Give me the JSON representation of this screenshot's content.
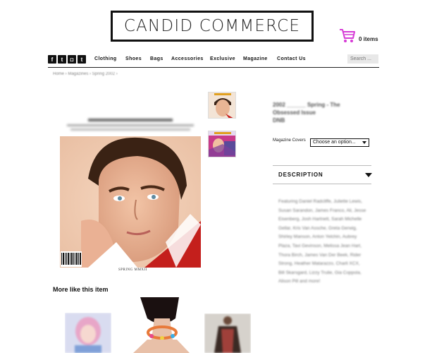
{
  "brand": {
    "logo_text": "CANDID COMMERCE"
  },
  "cart": {
    "count_label": "0 items",
    "icon": "shopping-cart-icon",
    "icon_color": "#d63ad6"
  },
  "social": [
    {
      "name": "facebook",
      "glyph": "f"
    },
    {
      "name": "twitter",
      "glyph": "t"
    },
    {
      "name": "instagram",
      "glyph": "◘"
    },
    {
      "name": "tumblr",
      "glyph": "t"
    }
  ],
  "nav": {
    "items": [
      "Clothing",
      "Shoes",
      "Bags",
      "Accessories",
      "Exclusive",
      "Magazine",
      "Contact Us"
    ],
    "search_placeholder": "Search ..."
  },
  "breadcrumb": "Home › Magazines › Spring 2002 ›",
  "product": {
    "title_line1": "2002 ______ Spring - The",
    "title_line2": "Obsessed Issue",
    "title_line3": "DNB",
    "option_label": "Magazine Covers",
    "option_value": "Choose an option...",
    "description_title": "DESCRIPTION",
    "description_text": "Featuring Daniel Radcliffe, Juliette Lewis, Susan Sarandon, James Franco, Ali, Jesse Eisenberg, Josh Hartnett, Sarah Michelle Gellar, Kris Van Assche, Greta Gerwig, Shirley Manson, Anton Yelchin, Aubrey Plaza, Tavi Gevinson, Melissa Jean Hart, Thora Birch, James Van Der Beek, Rider Strong, Heather Matarazzo, Charli XCX, Bill Skarsgard, Lizzy Trulie, Gia Coppola, Alison Pill and more!"
  },
  "cover": {
    "spring_label": "SPRING MMXII"
  },
  "related": {
    "heading": "More like this item"
  }
}
